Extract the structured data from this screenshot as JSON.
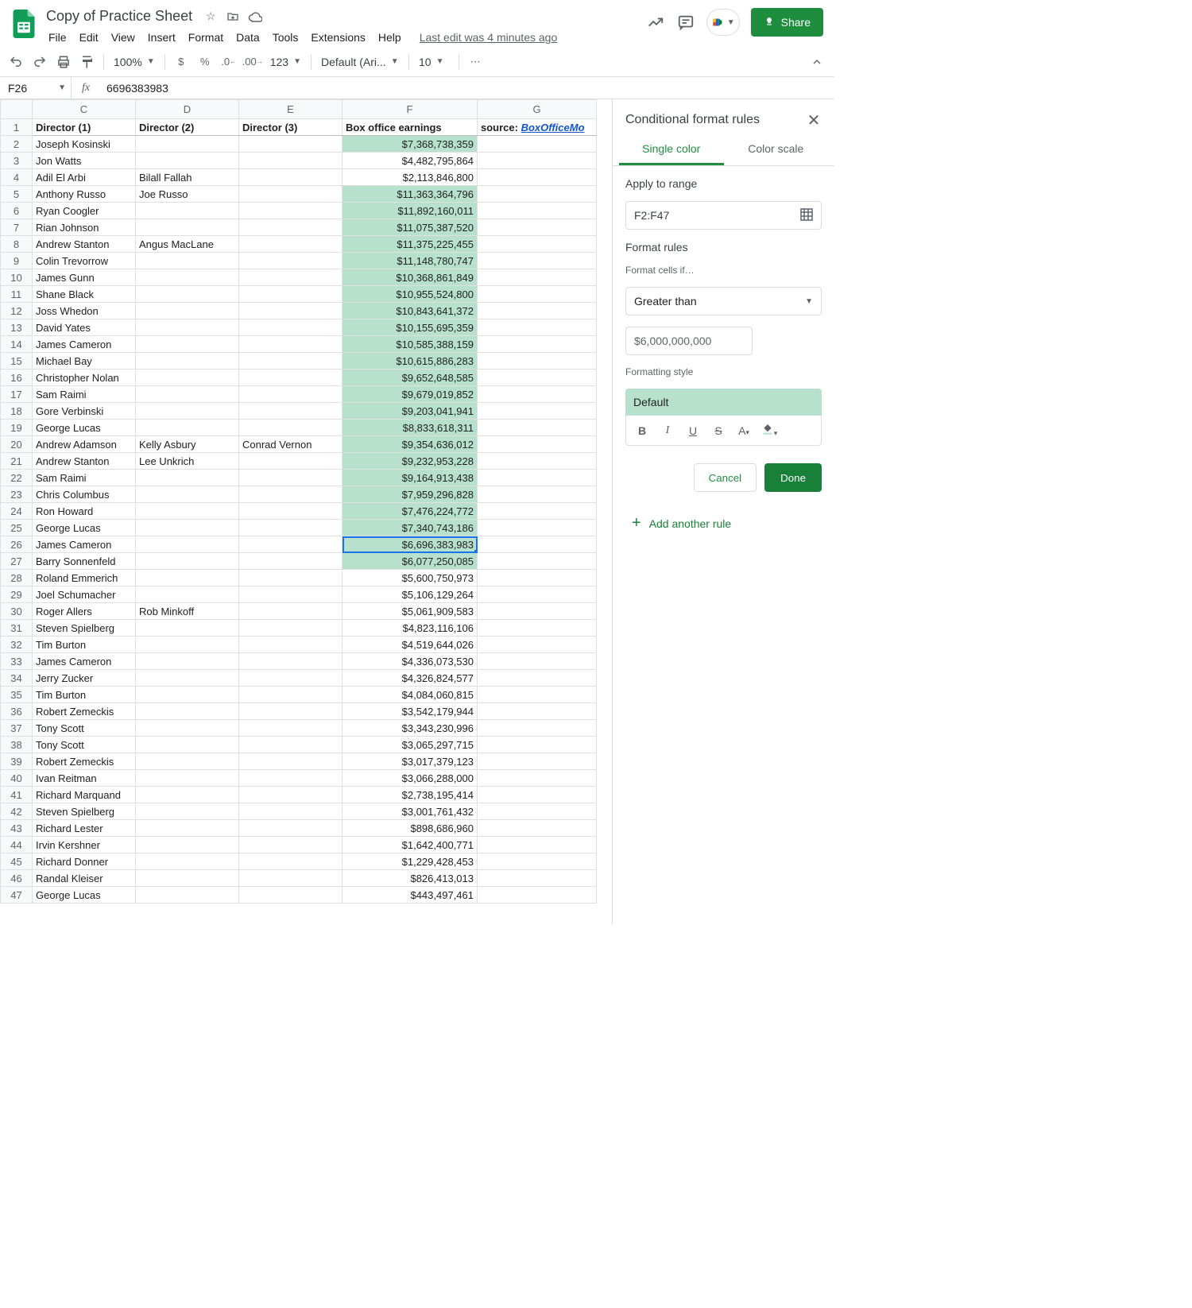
{
  "doc": {
    "title": "Copy of Practice Sheet",
    "last_edit": "Last edit was 4 minutes ago"
  },
  "menu": [
    "File",
    "Edit",
    "View",
    "Insert",
    "Format",
    "Data",
    "Tools",
    "Extensions",
    "Help"
  ],
  "share_label": "Share",
  "toolbar": {
    "zoom": "100%",
    "font": "Default (Ari...",
    "font_size": "10",
    "number_format": "123"
  },
  "namebox": "F26",
  "formula": "6696383983",
  "col_headers": [
    "C",
    "D",
    "E",
    "F",
    "G"
  ],
  "columns": {
    "c": "Director (1)",
    "d": "Director (2)",
    "e": "Director (3)",
    "f": "Box office earnings",
    "g_prefix": "source: ",
    "g_link": "BoxOfficeMo"
  },
  "highlight_threshold": 6000000000,
  "active_row": 26,
  "rows": [
    {
      "n": 2,
      "c": "Joseph Kosinski",
      "d": "",
      "e": "",
      "f": "$7,368,738,359",
      "v": 7368738359
    },
    {
      "n": 3,
      "c": "Jon Watts",
      "d": "",
      "e": "",
      "f": "$4,482,795,864",
      "v": 4482795864
    },
    {
      "n": 4,
      "c": "Adil El Arbi",
      "d": "Bilall Fallah",
      "e": "",
      "f": "$2,113,846,800",
      "v": 2113846800
    },
    {
      "n": 5,
      "c": "Anthony Russo",
      "d": "Joe Russo",
      "e": "",
      "f": "$11,363,364,796",
      "v": 11363364796
    },
    {
      "n": 6,
      "c": "Ryan Coogler",
      "d": "",
      "e": "",
      "f": "$11,892,160,011",
      "v": 11892160011
    },
    {
      "n": 7,
      "c": "Rian Johnson",
      "d": "",
      "e": "",
      "f": "$11,075,387,520",
      "v": 11075387520
    },
    {
      "n": 8,
      "c": "Andrew Stanton",
      "d": "Angus MacLane",
      "e": "",
      "f": "$11,375,225,455",
      "v": 11375225455
    },
    {
      "n": 9,
      "c": "Colin Trevorrow",
      "d": "",
      "e": "",
      "f": "$11,148,780,747",
      "v": 11148780747
    },
    {
      "n": 10,
      "c": "James Gunn",
      "d": "",
      "e": "",
      "f": "$10,368,861,849",
      "v": 10368861849
    },
    {
      "n": 11,
      "c": "Shane Black",
      "d": "",
      "e": "",
      "f": "$10,955,524,800",
      "v": 10955524800
    },
    {
      "n": 12,
      "c": "Joss Whedon",
      "d": "",
      "e": "",
      "f": "$10,843,641,372",
      "v": 10843641372
    },
    {
      "n": 13,
      "c": "David Yates",
      "d": "",
      "e": "",
      "f": "$10,155,695,359",
      "v": 10155695359
    },
    {
      "n": 14,
      "c": "James Cameron",
      "d": "",
      "e": "",
      "f": "$10,585,388,159",
      "v": 10585388159
    },
    {
      "n": 15,
      "c": "Michael Bay",
      "d": "",
      "e": "",
      "f": "$10,615,886,283",
      "v": 10615886283
    },
    {
      "n": 16,
      "c": "Christopher Nolan",
      "d": "",
      "e": "",
      "f": "$9,652,648,585",
      "v": 9652648585
    },
    {
      "n": 17,
      "c": "Sam Raimi",
      "d": "",
      "e": "",
      "f": "$9,679,019,852",
      "v": 9679019852
    },
    {
      "n": 18,
      "c": "Gore Verbinski",
      "d": "",
      "e": "",
      "f": "$9,203,041,941",
      "v": 9203041941
    },
    {
      "n": 19,
      "c": "George Lucas",
      "d": "",
      "e": "",
      "f": "$8,833,618,311",
      "v": 8833618311
    },
    {
      "n": 20,
      "c": "Andrew Adamson",
      "d": "Kelly Asbury",
      "e": "Conrad Vernon",
      "f": "$9,354,636,012",
      "v": 9354636012
    },
    {
      "n": 21,
      "c": "Andrew Stanton",
      "d": "Lee Unkrich",
      "e": "",
      "f": "$9,232,953,228",
      "v": 9232953228
    },
    {
      "n": 22,
      "c": "Sam Raimi",
      "d": "",
      "e": "",
      "f": "$9,164,913,438",
      "v": 9164913438
    },
    {
      "n": 23,
      "c": "Chris Columbus",
      "d": "",
      "e": "",
      "f": "$7,959,296,828",
      "v": 7959296828
    },
    {
      "n": 24,
      "c": "Ron Howard",
      "d": "",
      "e": "",
      "f": "$7,476,224,772",
      "v": 7476224772
    },
    {
      "n": 25,
      "c": "George Lucas",
      "d": "",
      "e": "",
      "f": "$7,340,743,186",
      "v": 7340743186
    },
    {
      "n": 26,
      "c": "James Cameron",
      "d": "",
      "e": "",
      "f": "$6,696,383,983",
      "v": 6696383983
    },
    {
      "n": 27,
      "c": "Barry Sonnenfeld",
      "d": "",
      "e": "",
      "f": "$6,077,250,085",
      "v": 6077250085
    },
    {
      "n": 28,
      "c": "Roland Emmerich",
      "d": "",
      "e": "",
      "f": "$5,600,750,973",
      "v": 5600750973
    },
    {
      "n": 29,
      "c": "Joel Schumacher",
      "d": "",
      "e": "",
      "f": "$5,106,129,264",
      "v": 5106129264
    },
    {
      "n": 30,
      "c": "Roger Allers",
      "d": "Rob Minkoff",
      "e": "",
      "f": "$5,061,909,583",
      "v": 5061909583
    },
    {
      "n": 31,
      "c": "Steven Spielberg",
      "d": "",
      "e": "",
      "f": "$4,823,116,106",
      "v": 4823116106
    },
    {
      "n": 32,
      "c": "Tim Burton",
      "d": "",
      "e": "",
      "f": "$4,519,644,026",
      "v": 4519644026
    },
    {
      "n": 33,
      "c": "James Cameron",
      "d": "",
      "e": "",
      "f": "$4,336,073,530",
      "v": 4336073530
    },
    {
      "n": 34,
      "c": "Jerry Zucker",
      "d": "",
      "e": "",
      "f": "$4,326,824,577",
      "v": 4326824577
    },
    {
      "n": 35,
      "c": "Tim Burton",
      "d": "",
      "e": "",
      "f": "$4,084,060,815",
      "v": 4084060815
    },
    {
      "n": 36,
      "c": "Robert Zemeckis",
      "d": "",
      "e": "",
      "f": "$3,542,179,944",
      "v": 3542179944
    },
    {
      "n": 37,
      "c": "Tony Scott",
      "d": "",
      "e": "",
      "f": "$3,343,230,996",
      "v": 3343230996
    },
    {
      "n": 38,
      "c": "Tony Scott",
      "d": "",
      "e": "",
      "f": "$3,065,297,715",
      "v": 3065297715
    },
    {
      "n": 39,
      "c": "Robert Zemeckis",
      "d": "",
      "e": "",
      "f": "$3,017,379,123",
      "v": 3017379123
    },
    {
      "n": 40,
      "c": "Ivan Reitman",
      "d": "",
      "e": "",
      "f": "$3,066,288,000",
      "v": 3066288000
    },
    {
      "n": 41,
      "c": "Richard Marquand",
      "d": "",
      "e": "",
      "f": "$2,738,195,414",
      "v": 2738195414
    },
    {
      "n": 42,
      "c": "Steven Spielberg",
      "d": "",
      "e": "",
      "f": "$3,001,761,432",
      "v": 3001761432
    },
    {
      "n": 43,
      "c": "Richard Lester",
      "d": "",
      "e": "",
      "f": "$898,686,960",
      "v": 898686960
    },
    {
      "n": 44,
      "c": "Irvin Kershner",
      "d": "",
      "e": "",
      "f": "$1,642,400,771",
      "v": 1642400771
    },
    {
      "n": 45,
      "c": "Richard Donner",
      "d": "",
      "e": "",
      "f": "$1,229,428,453",
      "v": 1229428453
    },
    {
      "n": 46,
      "c": "Randal Kleiser",
      "d": "",
      "e": "",
      "f": "$826,413,013",
      "v": 826413013
    },
    {
      "n": 47,
      "c": "George Lucas",
      "d": "",
      "e": "",
      "f": "$443,497,461",
      "v": 443497461
    }
  ],
  "panel": {
    "title": "Conditional format rules",
    "tab_single": "Single color",
    "tab_scale": "Color scale",
    "apply_label": "Apply to range",
    "range": "F2:F47",
    "rules_label": "Format rules",
    "cells_if": "Format cells if…",
    "condition": "Greater than",
    "value": "$6,000,000,000",
    "style_label": "Formatting style",
    "preview": "Default",
    "cancel": "Cancel",
    "done": "Done",
    "add": "Add another rule"
  }
}
